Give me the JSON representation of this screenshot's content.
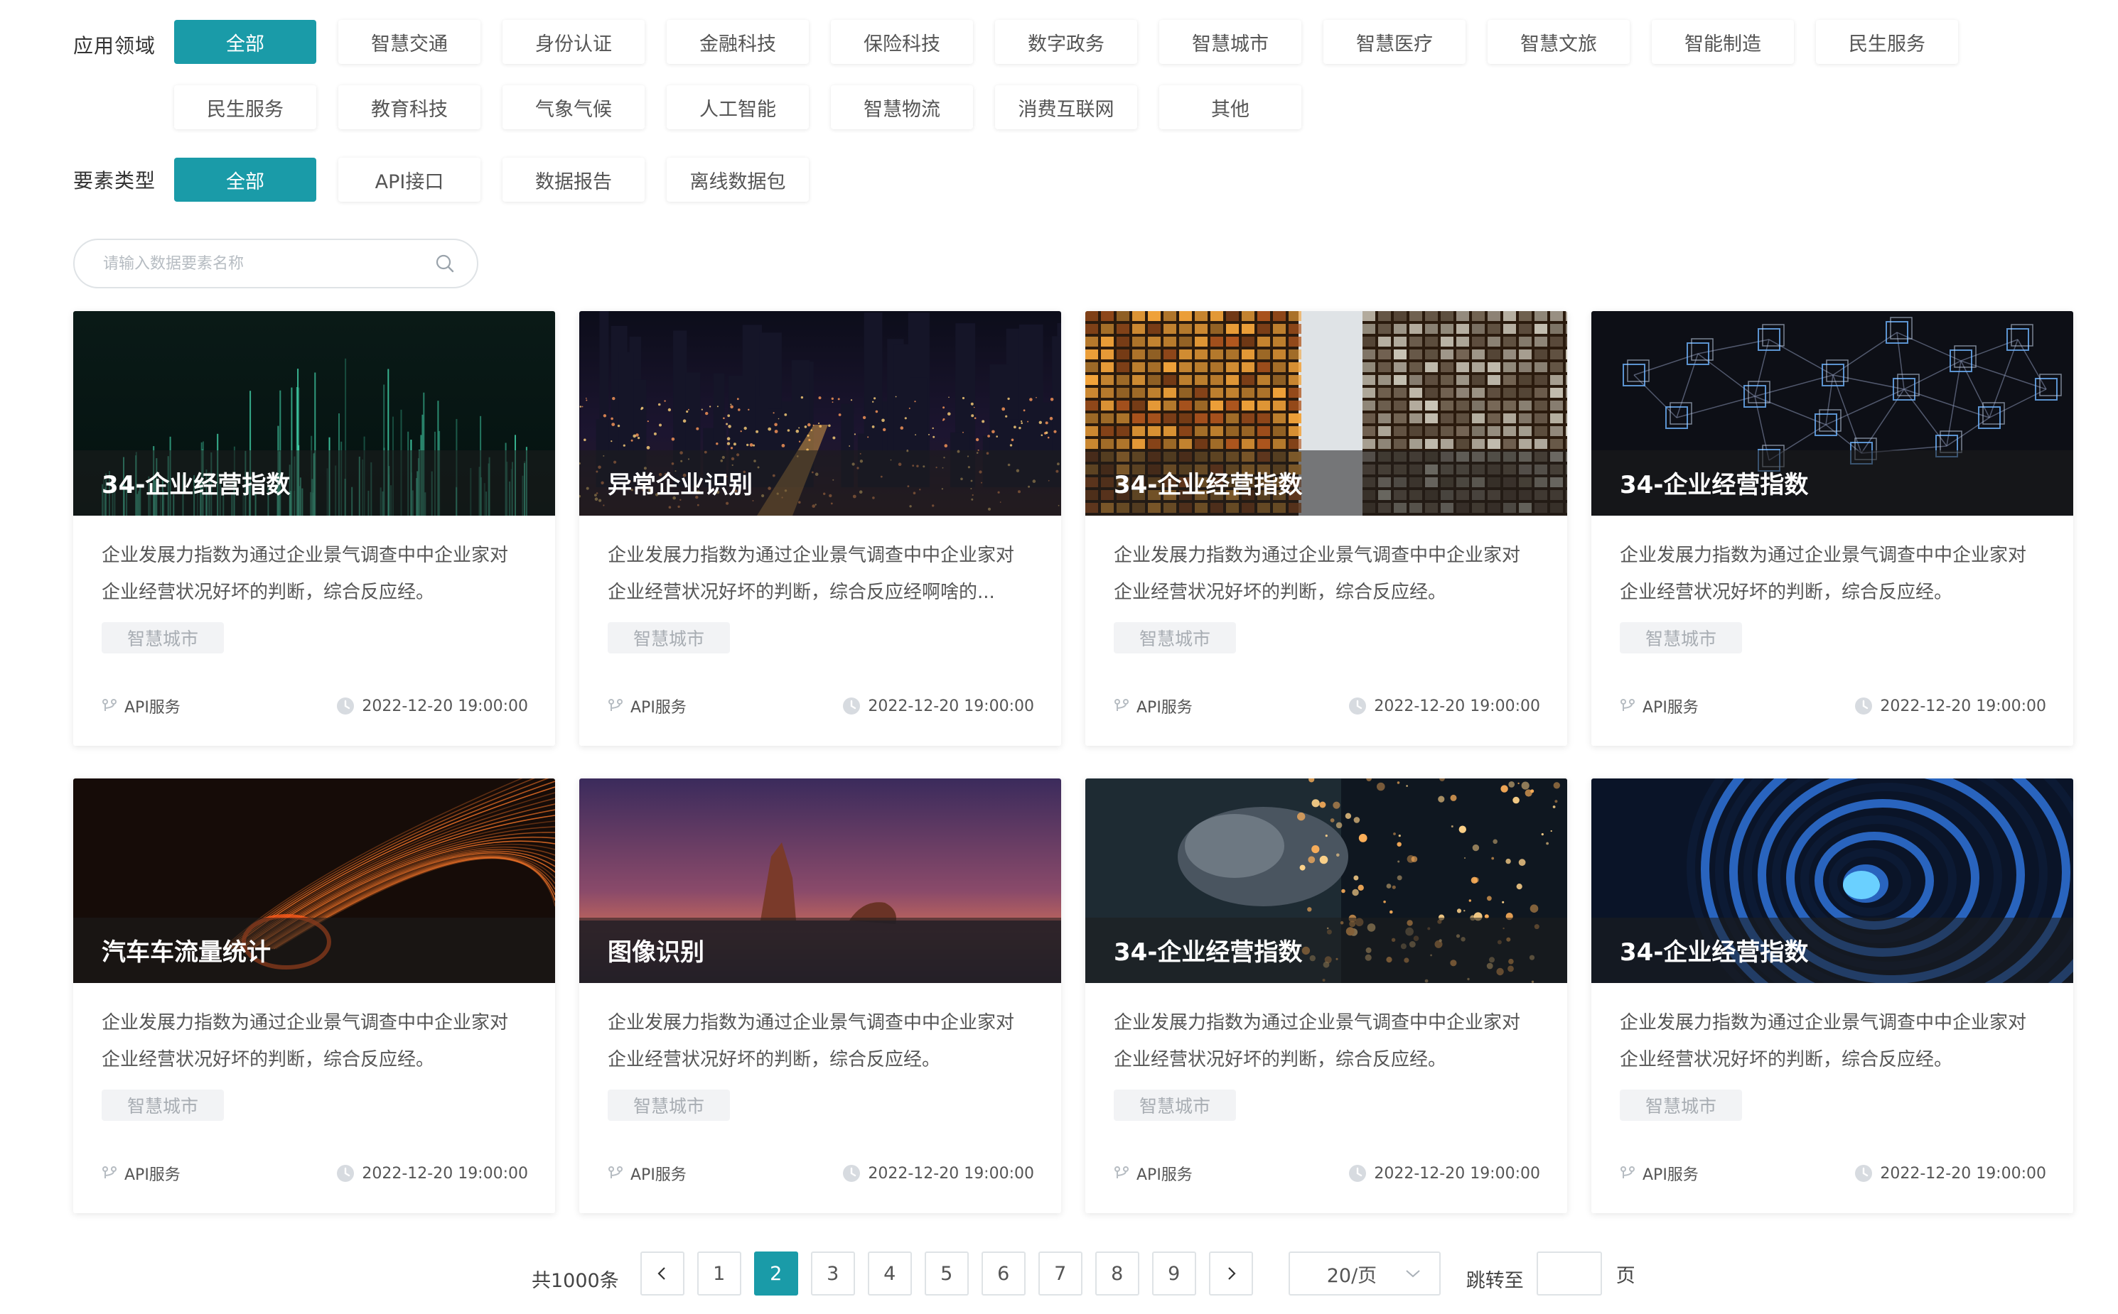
{
  "filters": {
    "domain": {
      "label": "应用领域",
      "options": [
        "全部",
        "智慧交通",
        "身份认证",
        "金融科技",
        "保险科技",
        "数字政务",
        "智慧城市",
        "智慧医疗",
        "智慧文旅",
        "智能制造",
        "民生服务",
        "民生服务",
        "教育科技",
        "气象气候",
        "人工智能",
        "智慧物流",
        "消费互联网",
        "其他"
      ],
      "active_index": 0
    },
    "type": {
      "label": "要素类型",
      "options": [
        "全部",
        "API接口",
        "数据报告",
        "离线数据包"
      ],
      "active_index": 0
    }
  },
  "search": {
    "placeholder": "请输入数据要素名称",
    "icon": "search-icon"
  },
  "cards": [
    {
      "title": "34-企业经营指数",
      "desc_line1": "企业发展力指数为通过企业景气调查中中企业家对",
      "desc_line2": "企业经营状况好坏的判断，综合反应经。",
      "tag": "智慧城市",
      "service": "API服务",
      "time": "2022-12-20 19:00:00",
      "image": "green-data-bars"
    },
    {
      "title": "异常企业识别",
      "desc_line1": "企业发展力指数为通过企业景气调查中中企业家对",
      "desc_line2": "企业经营状况好坏的判断，综合反应经啊啥的...",
      "tag": "智慧城市",
      "service": "API服务",
      "time": "2022-12-20 19:00:00",
      "image": "night-city"
    },
    {
      "title": "34-企业经营指数",
      "desc_line1": "企业发展力指数为通过企业景气调查中中企业家对",
      "desc_line2": "企业经营状况好坏的判断，综合反应经。",
      "tag": "智慧城市",
      "service": "API服务",
      "time": "2022-12-20 19:00:00",
      "image": "orange-buildings"
    },
    {
      "title": "34-企业经营指数",
      "desc_line1": "企业发展力指数为通过企业景气调查中中企业家对",
      "desc_line2": "企业经营状况好坏的判断，综合反应经。",
      "tag": "智慧城市",
      "service": "API服务",
      "time": "2022-12-20 19:00:00",
      "image": "blockchain-cubes"
    },
    {
      "title": "汽车车流量统计",
      "desc_line1": "企业发展力指数为通过企业景气调查中中企业家对",
      "desc_line2": "企业经营状况好坏的判断，综合反应经。",
      "tag": "智慧城市",
      "service": "API服务",
      "time": "2022-12-20 19:00:00",
      "image": "light-streaks"
    },
    {
      "title": "图像识别",
      "desc_line1": "企业发展力指数为通过企业景气调查中中企业家对",
      "desc_line2": "企业经营状况好坏的判断，综合反应经。",
      "tag": "智慧城市",
      "service": "API服务",
      "time": "2022-12-20 19:00:00",
      "image": "sea-rocks-dusk"
    },
    {
      "title": "34-企业经营指数",
      "desc_line1": "企业发展力指数为通过企业景气调查中中企业家对",
      "desc_line2": "企业经营状况好坏的判断，综合反应经。",
      "tag": "智慧城市",
      "service": "API服务",
      "time": "2022-12-20 19:00:00",
      "image": "grinder-sparks"
    },
    {
      "title": "34-企业经营指数",
      "desc_line1": "企业发展力指数为通过企业景气调查中中企业家对",
      "desc_line2": "企业经营状况好坏的判断，综合反应经。",
      "tag": "智慧城市",
      "service": "API服务",
      "time": "2022-12-20 19:00:00",
      "image": "blue-spiral"
    }
  ],
  "pagination": {
    "total": "共1000条",
    "pages": [
      "1",
      "2",
      "3",
      "4",
      "5",
      "6",
      "7",
      "8",
      "9"
    ],
    "current": "2",
    "page_size": "20/页",
    "jump_label": "跳转至",
    "jump_unit": "页"
  },
  "colors": {
    "accent": "#1a9ba8"
  }
}
